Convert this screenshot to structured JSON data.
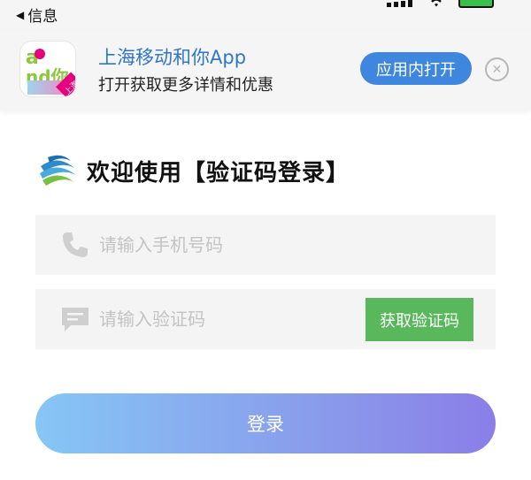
{
  "status_bar": {
    "back_label": "信息"
  },
  "banner": {
    "app_name": "上海移动和你App",
    "subtitle": "打开获取更多详情和优惠",
    "open_button": "应用内打开",
    "icon_tag": "上海",
    "brand_color": "#3f86de"
  },
  "login": {
    "heading": "欢迎使用【验证码登录】",
    "phone_placeholder": "请输入手机号码",
    "code_placeholder": "请输入验证码",
    "get_code_button": "获取验证码",
    "submit_button": "登录",
    "get_code_color": "#5ab85c"
  }
}
